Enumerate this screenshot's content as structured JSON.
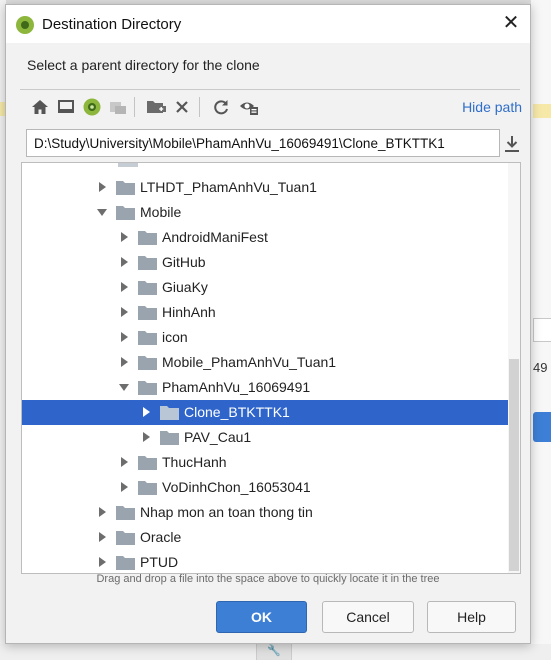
{
  "window": {
    "title": "Destination Directory"
  },
  "subtitle": "Select a parent directory for the clone",
  "toolbar": {
    "buttons": [
      {
        "icon": "home-icon"
      },
      {
        "icon": "desktop-icon"
      },
      {
        "icon": "android-project-icon"
      },
      {
        "icon": "module-icon"
      },
      {
        "icon": "new-folder-icon"
      },
      {
        "icon": "delete-icon"
      },
      {
        "icon": "refresh-icon"
      },
      {
        "icon": "show-hidden-icon"
      }
    ],
    "hide_path_label": "Hide path"
  },
  "path_value": "D:\\Study\\University\\Mobile\\PhamAnhVu_16069491\\Clone_BTKTTK1",
  "tree": [
    {
      "label": "LTHDT_PhamAnhVu_Tuan1",
      "depth": 0,
      "expanded": false,
      "selected": false
    },
    {
      "label": "Mobile",
      "depth": 0,
      "expanded": true,
      "selected": false
    },
    {
      "label": "AndroidManiFest",
      "depth": 1,
      "expanded": false,
      "selected": false
    },
    {
      "label": "GitHub",
      "depth": 1,
      "expanded": false,
      "selected": false
    },
    {
      "label": "GiuaKy",
      "depth": 1,
      "expanded": false,
      "selected": false
    },
    {
      "label": "HinhAnh",
      "depth": 1,
      "expanded": false,
      "selected": false
    },
    {
      "label": "icon",
      "depth": 1,
      "expanded": false,
      "selected": false
    },
    {
      "label": "Mobile_PhamAnhVu_Tuan1",
      "depth": 1,
      "expanded": false,
      "selected": false
    },
    {
      "label": "PhamAnhVu_16069491",
      "depth": 1,
      "expanded": true,
      "selected": false
    },
    {
      "label": "Clone_BTKTTK1",
      "depth": 2,
      "expanded": false,
      "selected": true
    },
    {
      "label": "PAV_Cau1",
      "depth": 2,
      "expanded": false,
      "selected": false
    },
    {
      "label": "ThucHanh",
      "depth": 1,
      "expanded": false,
      "selected": false
    },
    {
      "label": "VoDinhChon_16053041",
      "depth": 1,
      "expanded": false,
      "selected": false
    },
    {
      "label": "Nhap mon an toan thong tin",
      "depth": 0,
      "expanded": false,
      "selected": false
    },
    {
      "label": "Oracle",
      "depth": 0,
      "expanded": false,
      "selected": false
    },
    {
      "label": "PTUD",
      "depth": 0,
      "expanded": false,
      "selected": false
    }
  ],
  "hint": "Drag and drop a file into the space above to quickly locate it in the tree",
  "buttons": {
    "ok": "OK",
    "cancel": "Cancel",
    "help": "Help"
  },
  "background": {
    "right_text": "49"
  },
  "colors": {
    "accent": "#3c7fd4",
    "selection": "#2f65ca",
    "link": "#2f6ec9",
    "folder": "#9aa4ae"
  }
}
